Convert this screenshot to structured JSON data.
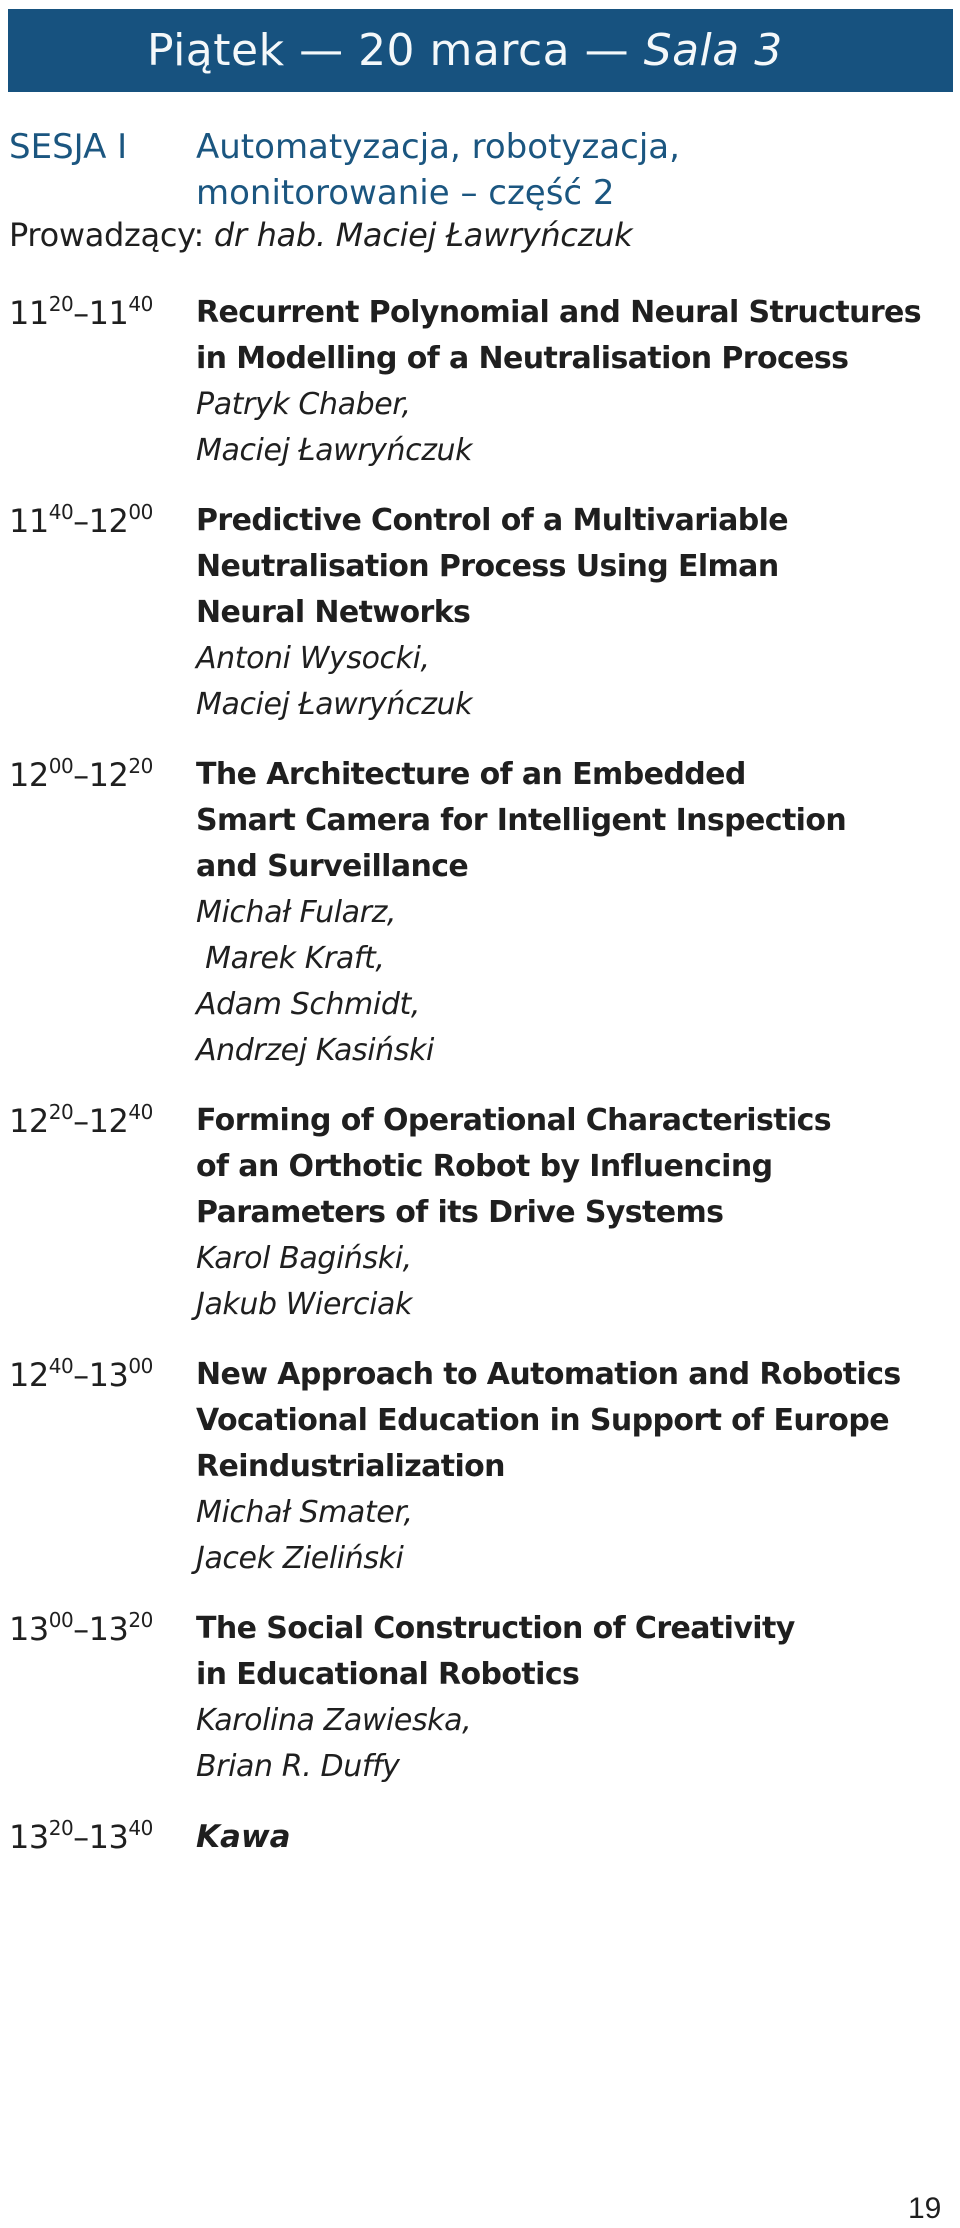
{
  "header": {
    "day": "Piątek",
    "separator": "—",
    "date": "20 marca",
    "room": "Sala 3"
  },
  "session": {
    "label": "SESJA I",
    "title_lines": [
      "Automatyzacja, robotyzacja,",
      "monitorowanie – część 2"
    ],
    "color": "#1b5680"
  },
  "chair": {
    "label": "Prowadzący:",
    "name": "dr hab. Maciej Ławryńczuk"
  },
  "header_color": "#17527f",
  "items": [
    {
      "start_h": "11",
      "start_m": "20",
      "end_h": "11",
      "end_m": "40",
      "title_lines": [
        "Recurrent Polynomial and Neural Structures",
        "in Modelling of a Neutralisation Process"
      ],
      "authors": [
        "Patryk Chaber,",
        "Maciej Ławryńczuk"
      ]
    },
    {
      "start_h": "11",
      "start_m": "40",
      "end_h": "12",
      "end_m": "00",
      "title_lines": [
        "Predictive Control of a Multivariable",
        "Neutralisation Process Using Elman",
        "Neural Networks"
      ],
      "authors": [
        "Antoni Wysocki,",
        "Maciej Ławryńczuk"
      ]
    },
    {
      "start_h": "12",
      "start_m": "00",
      "end_h": "12",
      "end_m": "20",
      "title_lines": [
        "The Architecture of an Embedded",
        "Smart Camera for Intelligent Inspection",
        "and Surveillance"
      ],
      "authors": [
        "Michał Fularz,",
        " Marek Kraft,",
        "Adam Schmidt,",
        "Andrzej Kasiński"
      ]
    },
    {
      "start_h": "12",
      "start_m": "20",
      "end_h": "12",
      "end_m": "40",
      "title_lines": [
        "Forming of Operational Characteristics",
        "of an Orthotic Robot by Influencing",
        "Parameters of its Drive Systems"
      ],
      "authors": [
        "Karol Bagiński,",
        "Jakub Wierciak"
      ]
    },
    {
      "start_h": "12",
      "start_m": "40",
      "end_h": "13",
      "end_m": "00",
      "title_lines": [
        "New Approach to Automation and Robotics",
        "Vocational Education in Support of Europe",
        "Reindustrialization"
      ],
      "authors": [
        "Michał Smater,",
        "Jacek Zieliński"
      ]
    },
    {
      "start_h": "13",
      "start_m": "00",
      "end_h": "13",
      "end_m": "20",
      "title_lines": [
        "The Social Construction of Creativity",
        "in Educational Robotics"
      ],
      "authors": [
        "Karolina Zawieska,",
        "Brian R. Duffy"
      ]
    }
  ],
  "break": {
    "start_h": "13",
    "start_m": "20",
    "end_h": "13",
    "end_m": "40",
    "label": "Kawa"
  },
  "page_number": "19",
  "time_dash": "–"
}
